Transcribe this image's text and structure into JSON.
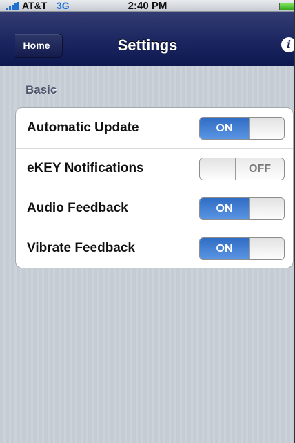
{
  "status_bar": {
    "carrier": "AT&T",
    "network": "3G",
    "time": "2:40 PM"
  },
  "nav_bar": {
    "back_label": "Home",
    "title": "Settings"
  },
  "section": {
    "header": "Basic"
  },
  "settings": [
    {
      "label": "Automatic Update",
      "state": "ON"
    },
    {
      "label": "eKEY Notifications",
      "state": "OFF"
    },
    {
      "label": "Audio Feedback",
      "state": "ON"
    },
    {
      "label": "Vibrate Feedback",
      "state": "ON"
    }
  ],
  "colors": {
    "nav_bar": "#1d2761",
    "toggle_on": "#3f7ed6",
    "network": "#1b6fd8"
  }
}
